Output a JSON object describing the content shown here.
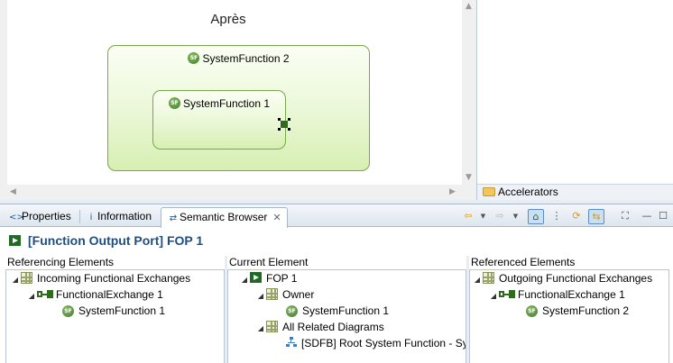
{
  "diagram": {
    "title": "Après",
    "outer_function": {
      "icon_text": "SF",
      "label": "SystemFunction 2"
    },
    "inner_function": {
      "icon_text": "SF",
      "label": "SystemFunction 1"
    }
  },
  "right_panel": {
    "accelerators_label": "Accelerators"
  },
  "tabs": [
    {
      "label": "Properties",
      "icon": "properties-icon"
    },
    {
      "label": "Information",
      "icon": "information-icon"
    },
    {
      "label": "Semantic Browser",
      "icon": "semantic-browser-icon",
      "active": true
    }
  ],
  "toolbar": [
    "back-icon",
    "back-menu-icon",
    "forward-icon",
    "forward-menu-icon",
    "show-diagram-icon",
    "expand-all-icon",
    "refresh-icon",
    "link-with-editor-icon",
    "layout-icon",
    "minimize-icon",
    "maximize-icon"
  ],
  "element_header": {
    "title": "[Function Output Port] FOP 1"
  },
  "columns": {
    "referencing": {
      "header": "Referencing Elements",
      "items": [
        {
          "label": "Incoming Functional Exchanges",
          "icon": "category-icon"
        },
        {
          "label": "FunctionalExchange 1",
          "icon": "functional-exchange-icon"
        },
        {
          "label": "SystemFunction 1",
          "icon": "system-function-icon",
          "icon_text": "SF"
        }
      ]
    },
    "current": {
      "header": "Current Element",
      "items": [
        {
          "label": "FOP 1",
          "icon": "function-output-port-icon"
        },
        {
          "label": "Owner",
          "icon": "category-icon"
        },
        {
          "label": "SystemFunction 1",
          "icon": "system-function-icon",
          "icon_text": "SF"
        },
        {
          "label": "All Related Diagrams",
          "icon": "category-icon"
        },
        {
          "label": "[SDFB] Root System Function - Sy",
          "icon": "diagram-icon"
        }
      ]
    },
    "referenced": {
      "header": "Referenced Elements",
      "items": [
        {
          "label": "Outgoing Functional Exchanges",
          "icon": "category-icon"
        },
        {
          "label": "FunctionalExchange 1",
          "icon": "functional-exchange-icon"
        },
        {
          "label": "SystemFunction 2",
          "icon": "system-function-icon",
          "icon_text": "SF"
        }
      ]
    }
  },
  "colors": {
    "function_fill": "#eaf7d6",
    "function_border": "#77a94b",
    "header_text": "#1c4f86",
    "icon_green": "#2f6a1f"
  }
}
